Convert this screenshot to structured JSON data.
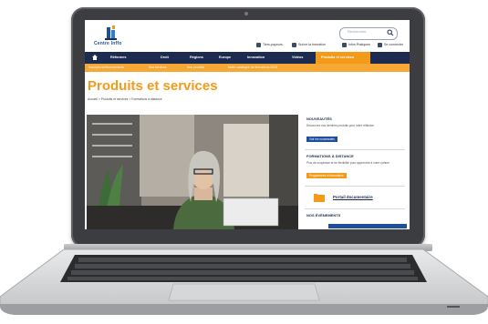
{
  "site": {
    "logo_text": "Centre Inffo",
    "search_placeholder": "Rechercher"
  },
  "toplinks": [
    {
      "label": "Tiers-payeurs",
      "icon": "cart-icon"
    },
    {
      "label": "Suivre la formation",
      "icon": "graduation-cap-icon"
    },
    {
      "label": "Infos Pratiques",
      "icon": "grid-icon"
    },
    {
      "label": "Se connecter",
      "icon": "user-icon"
    }
  ],
  "nav": {
    "items": [
      "Réformes",
      "Droit",
      "Régions",
      "Europe",
      "Innovation",
      "Vidéos"
    ],
    "active": "Produits et services"
  },
  "subnav": [
    "Inscriptions/Abonnements",
    "Nos services",
    "Nos produits",
    "Notre catalogue de formations 2023"
  ],
  "page": {
    "title": "Produits et services",
    "breadcrumb": "Accueil  >  Produits et services  >  Formations à distance"
  },
  "sidebar": {
    "news_heading": "NOUVEAUTÉS",
    "news_text": "Découvrez nos derniers produits pour votre réflexion",
    "news_button": "Voir les nouveautés",
    "distance_heading": "FORMATIONS À DISTANCE",
    "distance_text": "Plus de souplesse et de flexibilité pour apprendre à votre rythme",
    "distance_button": "Programmes et formations",
    "docs_link": "Portail documentaire",
    "events_heading": "NOS ÉVÉNEMENTS"
  },
  "colors": {
    "navy": "#1c2b4f",
    "orange": "#f39a1b",
    "blue": "#1f4e9c"
  }
}
